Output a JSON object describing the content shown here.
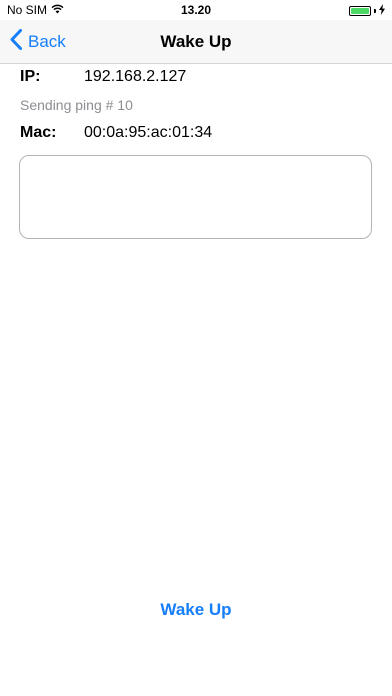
{
  "status_bar": {
    "carrier": "No SIM",
    "time": "13.20",
    "battery_color": "#4cd964"
  },
  "nav": {
    "back_label": "Back",
    "title": "Wake Up"
  },
  "details": {
    "ip_label": "IP:",
    "ip_value": "192.168.2.127",
    "status_message": "Sending ping # 10",
    "mac_label": "Mac:",
    "mac_value": "00:0a:95:ac:01:34"
  },
  "log_box": {
    "value": ""
  },
  "actions": {
    "wake_label": "Wake Up"
  },
  "colors": {
    "accent": "#157efb",
    "secondary_text": "#8e8e93"
  }
}
